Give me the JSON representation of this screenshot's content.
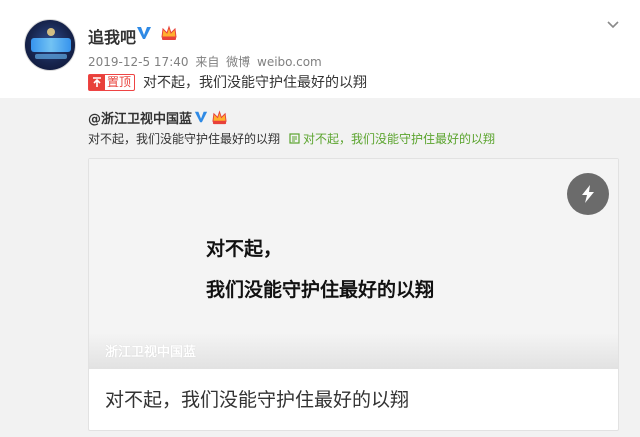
{
  "author": {
    "name": "追我吧",
    "verified_icon": "verified-v-icon",
    "member_icon": "vip-crown-icon"
  },
  "meta": {
    "timestamp": "2019-12-5 17:40",
    "source_prefix": "来自",
    "source_app": "微博",
    "source_domain": "weibo.com"
  },
  "post": {
    "pin_label": "置顶",
    "text": "对不起，我们没能守护住最好的以翔"
  },
  "repost": {
    "author": "@浙江卫视中国蓝",
    "text": "对不起，我们没能守护住最好的以翔",
    "link_text": "对不起，我们没能守护住最好的以翔",
    "card": {
      "headline_line1": "对不起，",
      "headline_line2": "我们没能守护住最好的以翔",
      "watermark": "浙江卫视中国蓝",
      "caption": "对不起，我们没能守护住最好的以翔"
    }
  },
  "colors": {
    "accent_red": "#e8413a",
    "link_green": "#5ba42e",
    "verified_blue": "#2f8ae5",
    "repost_bg": "#f2f2f2"
  }
}
